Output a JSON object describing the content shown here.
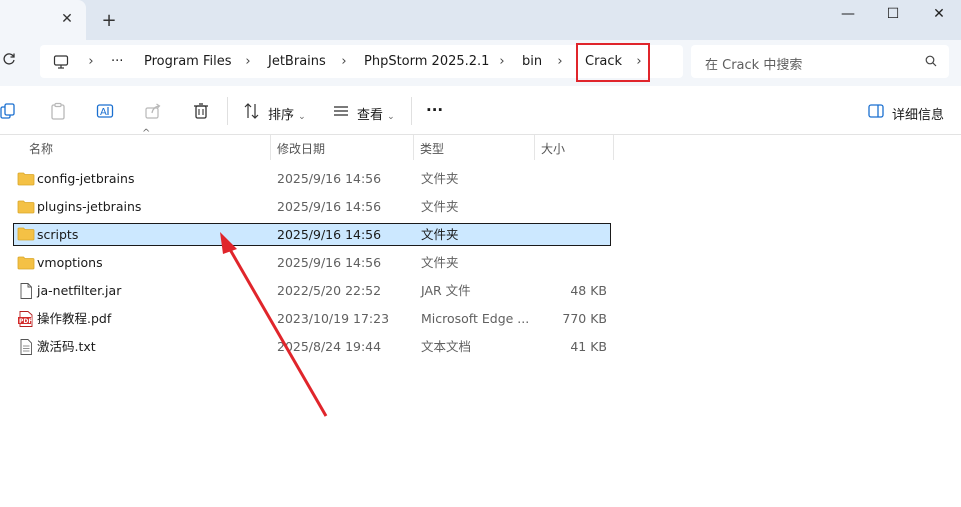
{
  "window": {
    "new_tab_glyph": "+",
    "close_tab_glyph": "✕",
    "minimize_glyph": "—",
    "maximize_glyph": "☐",
    "close_glyph": "✕"
  },
  "address": {
    "more_glyph": "···",
    "crumbs": [
      "Program Files",
      "JetBrains",
      "PhpStorm 2025.2.1",
      "bin",
      "Crack"
    ],
    "separator": "›"
  },
  "search": {
    "placeholder": "在 Crack 中搜索"
  },
  "toolbar": {
    "sort_label": "排序",
    "view_label": "查看",
    "more_label": "···",
    "details_label": "详细信息"
  },
  "columns": {
    "name": "名称",
    "modified": "修改日期",
    "type": "类型",
    "size": "大小"
  },
  "files": [
    {
      "name": "config-jetbrains",
      "modified": "2025/9/16 14:56",
      "type": "文件夹",
      "size": "",
      "icon": "folder-icon"
    },
    {
      "name": "plugins-jetbrains",
      "modified": "2025/9/16 14:56",
      "type": "文件夹",
      "size": "",
      "icon": "folder-icon"
    },
    {
      "name": "scripts",
      "modified": "2025/9/16 14:56",
      "type": "文件夹",
      "size": "",
      "icon": "folder-icon",
      "selected": true
    },
    {
      "name": "vmoptions",
      "modified": "2025/9/16 14:56",
      "type": "文件夹",
      "size": "",
      "icon": "folder-icon"
    },
    {
      "name": "ja-netfilter.jar",
      "modified": "2022/5/20 22:52",
      "type": "JAR 文件",
      "size": "48 KB",
      "icon": "file-icon"
    },
    {
      "name": "操作教程.pdf",
      "modified": "2023/10/19 17:23",
      "type": "Microsoft Edge ...",
      "size": "770 KB",
      "icon": "pdf-icon"
    },
    {
      "name": "激活码.txt",
      "modified": "2025/8/24 19:44",
      "type": "文本文档",
      "size": "41 KB",
      "icon": "text-file-icon"
    }
  ],
  "colors": {
    "highlight_box": "#e0252b",
    "selection": "#cce8ff",
    "arrow": "#e0252b",
    "folder": "#f4c145"
  }
}
